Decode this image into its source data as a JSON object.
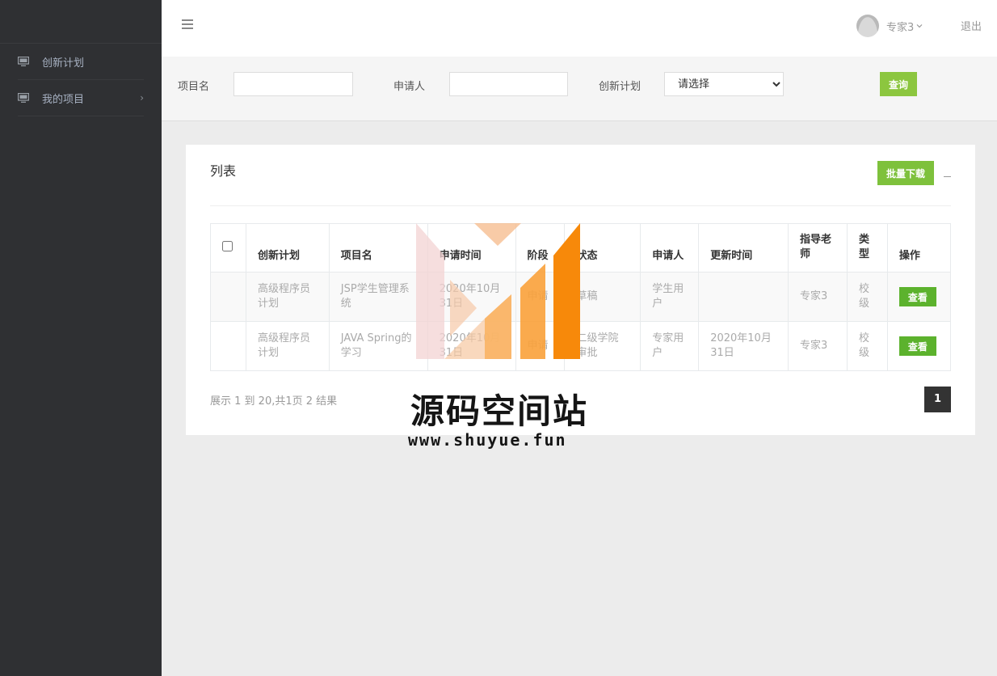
{
  "sidebar": {
    "items": [
      {
        "label": "创新计划",
        "icon": "monitor-icon",
        "has_children": false
      },
      {
        "label": "我的项目",
        "icon": "monitor-icon",
        "has_children": true
      }
    ]
  },
  "header": {
    "user_name": "专家3",
    "logout": "退出"
  },
  "filters": {
    "project_name_label": "项目名",
    "project_name_value": "",
    "applicant_label": "申请人",
    "applicant_value": "",
    "plan_label": "创新计划",
    "plan_selected": "请选择",
    "query_button": "查询"
  },
  "panel": {
    "title": "列表",
    "batch_download": "批量下载"
  },
  "table": {
    "columns": [
      "创新计划",
      "项目名",
      "申请时间",
      "阶段",
      "状态",
      "申请人",
      "更新时间",
      "指导老师",
      "类型",
      "操作"
    ],
    "rows": [
      {
        "plan": "高级程序员计划",
        "name": "JSP学生管理系统",
        "apply_time": "2020年10月31日",
        "stage": "申请",
        "status": "草稿",
        "applicant": "学生用户",
        "update_time": "",
        "teacher": "专家3",
        "type": "校级",
        "action": "查看"
      },
      {
        "plan": "高级程序员计划",
        "name": "JAVA Spring的学习",
        "apply_time": "2020年10月31日",
        "stage": "申请",
        "status": "二级学院审批",
        "applicant": "专家用户",
        "update_time": "2020年10月31日",
        "teacher": "专家3",
        "type": "校级",
        "action": "查看"
      }
    ]
  },
  "pagination": {
    "info": "展示 1 到 20,共1页 2 结果",
    "current_page": "1"
  },
  "watermark": {
    "title": "源码空间站",
    "url": "www.shuyue.fun"
  },
  "colors": {
    "sidebar_bg": "#2f3033",
    "accent_green": "#8cc63f",
    "view_button": "#5cb22d",
    "watermark_orange": "#f7941d"
  }
}
